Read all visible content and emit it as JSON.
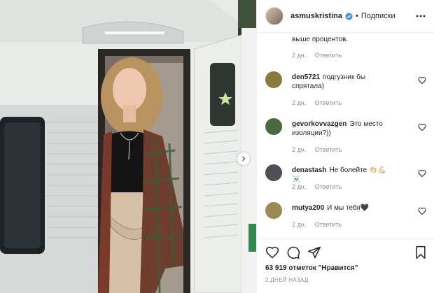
{
  "header": {
    "username": "asmuskristina",
    "separator": "•",
    "follow_label": "Подписки"
  },
  "comments": {
    "partial_text": "выше процентов.",
    "partial_meta": {
      "age": "2 дн.",
      "reply": "Ответить"
    },
    "items": [
      {
        "username": "den5721",
        "text": "подгузник бы спрятала)",
        "age": "2 дн.",
        "reply": "Ответить",
        "avatar_color": "#8a7a3c"
      },
      {
        "username": "gevorkovvazgen",
        "text": "Это место изоляции?))",
        "age": "2 дн.",
        "reply": "Ответить",
        "avatar_color": "#4a6b3f"
      },
      {
        "username": "denastash",
        "text": "Не болейте 👏🏻💪🏻 ☠️",
        "age": "2 дн.",
        "reply": "Ответить",
        "avatar_color": "#4f4f55"
      },
      {
        "username": "mutya200",
        "text": "И мы тебя🖤",
        "age": "2 дн.",
        "reply": "Ответить",
        "avatar_color": "#9c8a55"
      }
    ]
  },
  "actions": {
    "likes": "63 919 отметок \"Нравится\"",
    "timestamp": "2 ДНЕЙ НАЗАД"
  },
  "icons": {
    "verified": "verified-badge-icon",
    "more": "more-dots-icon",
    "like": "heart-icon",
    "comment": "comment-icon",
    "share": "send-icon",
    "save": "bookmark-icon",
    "next": "chevron-right-icon"
  },
  "colors": {
    "verified": "#3897f0",
    "text": "#262626",
    "secondary": "#8e8e8e",
    "border": "#efefef"
  }
}
